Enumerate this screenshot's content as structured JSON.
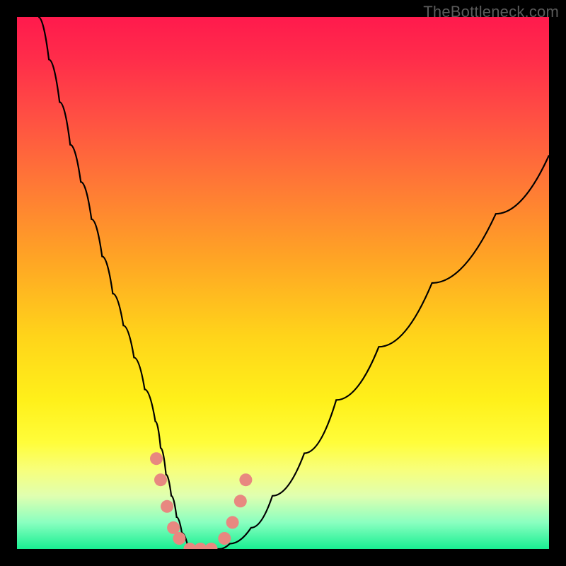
{
  "watermark": "TheBottleneck.com",
  "chart_data": {
    "type": "line",
    "title": "",
    "xlabel": "",
    "ylabel": "",
    "xlim": [
      0,
      100
    ],
    "ylim": [
      0,
      100
    ],
    "series": [
      {
        "name": "bottleneck-curve",
        "x": [
          4,
          6,
          8,
          10,
          12,
          14,
          16,
          18,
          20,
          22,
          24,
          26,
          27,
          28,
          29,
          30,
          31,
          32,
          33,
          34,
          36,
          38,
          40,
          44,
          48,
          54,
          60,
          68,
          78,
          90,
          100
        ],
        "values": [
          100,
          92,
          84,
          76,
          69,
          62,
          55,
          48,
          42,
          36,
          30,
          24,
          19,
          14,
          10,
          6,
          3,
          1,
          0,
          0,
          0,
          0,
          1,
          4,
          10,
          18,
          28,
          38,
          50,
          63,
          74
        ]
      }
    ],
    "markers": [
      {
        "name": "left-cluster-1",
        "x": 26.2,
        "y": 17
      },
      {
        "name": "left-cluster-2",
        "x": 27.0,
        "y": 13
      },
      {
        "name": "left-cluster-3",
        "x": 28.2,
        "y": 8
      },
      {
        "name": "left-cluster-4",
        "x": 29.4,
        "y": 4
      },
      {
        "name": "left-cluster-5",
        "x": 30.5,
        "y": 2
      },
      {
        "name": "valley-1",
        "x": 32.5,
        "y": 0
      },
      {
        "name": "valley-2",
        "x": 34.5,
        "y": 0
      },
      {
        "name": "valley-3",
        "x": 36.5,
        "y": 0
      },
      {
        "name": "right-cluster-1",
        "x": 39.0,
        "y": 2
      },
      {
        "name": "right-cluster-2",
        "x": 40.5,
        "y": 5
      },
      {
        "name": "right-cluster-3",
        "x": 42.0,
        "y": 9
      },
      {
        "name": "right-cluster-4",
        "x": 43.0,
        "y": 13
      }
    ],
    "marker_color": "#e88880",
    "curve_color": "#000000"
  }
}
